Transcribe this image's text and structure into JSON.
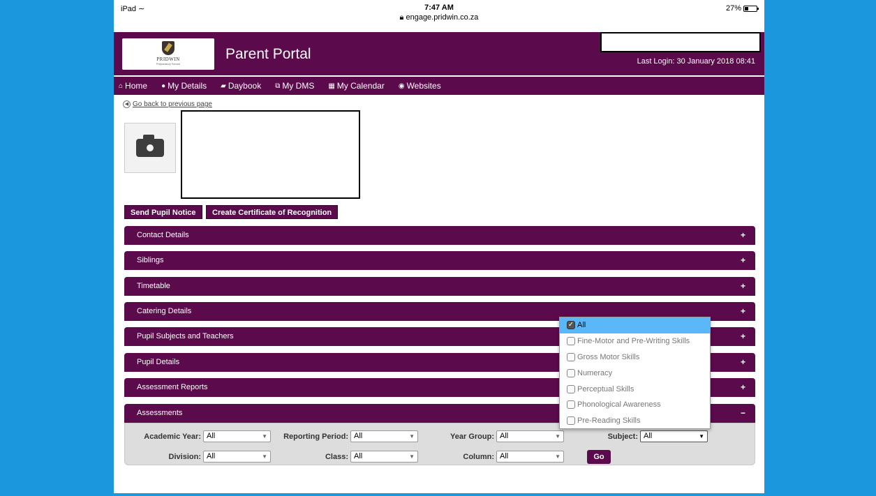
{
  "status_bar": {
    "device": "iPad",
    "wifi_icon": "wifi-icon",
    "time": "7:47 AM",
    "url": "engage.pridwin.co.za",
    "battery": "27%"
  },
  "header": {
    "logo_name": "PRIDWIN",
    "logo_sub": "Preparatory School",
    "title": "Parent Portal",
    "last_login": "Last Login: 30 January 2018 08:41"
  },
  "nav": {
    "items": [
      {
        "label": "Home",
        "icon": "⌂"
      },
      {
        "label": "My Details",
        "icon": "●"
      },
      {
        "label": "Daybook",
        "icon": "▰"
      },
      {
        "label": "My DMS",
        "icon": "⧉"
      },
      {
        "label": "My Calendar",
        "icon": "▦"
      },
      {
        "label": "Websites",
        "icon": "◉"
      }
    ]
  },
  "back_link": "Go back to previous page",
  "buttons": {
    "send_notice": "Send Pupil Notice",
    "certificate": "Create Certificate of Recognition"
  },
  "sections": [
    {
      "label": "Contact Details",
      "sign": "+"
    },
    {
      "label": "Siblings",
      "sign": "+"
    },
    {
      "label": "Timetable",
      "sign": "+"
    },
    {
      "label": "Catering Details",
      "sign": "+"
    },
    {
      "label": "Pupil Subjects and Teachers",
      "sign": "+"
    },
    {
      "label": "Pupil Details",
      "sign": "+"
    },
    {
      "label": "Assessment Reports",
      "sign": "+"
    },
    {
      "label": "Assessments",
      "sign": "−"
    }
  ],
  "filters": {
    "academic_year": {
      "label": "Academic Year:",
      "value": "All"
    },
    "reporting_period": {
      "label": "Reporting Period:",
      "value": "All"
    },
    "year_group": {
      "label": "Year Group:",
      "value": "All"
    },
    "subject": {
      "label": "Subject:",
      "value": "All"
    },
    "division": {
      "label": "Division:",
      "value": "All"
    },
    "class": {
      "label": "Class:",
      "value": "All"
    },
    "column": {
      "label": "Column:",
      "value": "All"
    },
    "go": "Go"
  },
  "subject_dropdown": {
    "options": [
      {
        "label": "All",
        "checked": true
      },
      {
        "label": "Fine-Motor and Pre-Writing Skills",
        "checked": false
      },
      {
        "label": "Gross Motor Skills",
        "checked": false
      },
      {
        "label": "Numeracy",
        "checked": false
      },
      {
        "label": "Perceptual Skills",
        "checked": false
      },
      {
        "label": "Phonological Awareness",
        "checked": false
      },
      {
        "label": "Pre-Reading Skills",
        "checked": false
      }
    ]
  },
  "colors": {
    "brand_purple": "#5b0a4b",
    "page_blue": "#1a97dd",
    "dropdown_highlight": "#5ab8f8"
  }
}
